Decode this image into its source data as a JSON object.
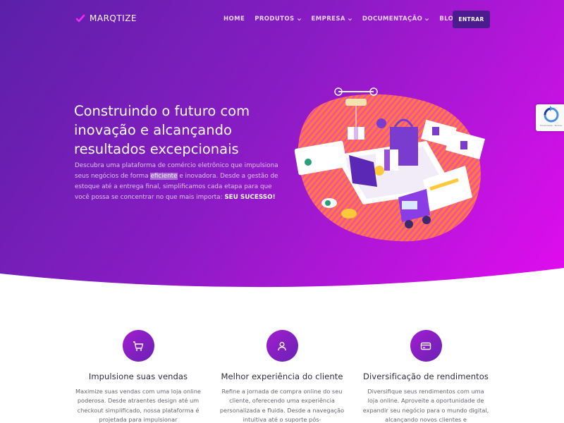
{
  "brand": {
    "name": "MARQTIZE",
    "logo_icon": "check-mark-icon",
    "accent": "#e91ff0",
    "button_color": "#4a1c8e"
  },
  "nav": {
    "items": [
      {
        "label": "HOME",
        "dropdown": false
      },
      {
        "label": "PRODUTOS",
        "dropdown": true
      },
      {
        "label": "EMPRESA",
        "dropdown": true
      },
      {
        "label": "DOCUMENTAÇÃO",
        "dropdown": true
      },
      {
        "label": "BLOG",
        "dropdown": false
      }
    ],
    "cta": "ENTRAR"
  },
  "hero": {
    "title": "Construindo o futuro com inovação e alcançando resultados excepcionais",
    "desc_1": "Descubra uma plataforma de comércio eletrônico que impulsiona seus negócios de forma",
    "desc_highlight": "eficiente",
    "desc_2": "e inovadora. Desde a gestão de estoque até a entrega final, simplificamos cada etapa para que você possa se concentrar no que mais importa:",
    "desc_strong": "SEU SUCESSO!"
  },
  "recaptcha": {
    "label": "Privacidade - Termos"
  },
  "features": [
    {
      "icon": "shopping-cart-icon",
      "title": "Impulsione suas vendas",
      "desc": "Maximize suas vendas com uma loja online poderosa. Desde atraentes design até um checkout simplificado, nossa plataforma é projetada para impulsionar"
    },
    {
      "icon": "user-icon",
      "title": "Melhor experiência do cliente",
      "desc": "Refine a jornada de compra online do seu cliente, oferecendo uma experiência personalizada e fluida. Desde a navegação intuitiva até o suporte pós-"
    },
    {
      "icon": "credit-card-icon",
      "title": "Diversificação de rendimentos",
      "desc": "Diversifique seus rendimentos com uma loja online. Aproveite a oportunidade de expandir seu negócio para o mundo digital, alcançando novos clientes e"
    }
  ]
}
